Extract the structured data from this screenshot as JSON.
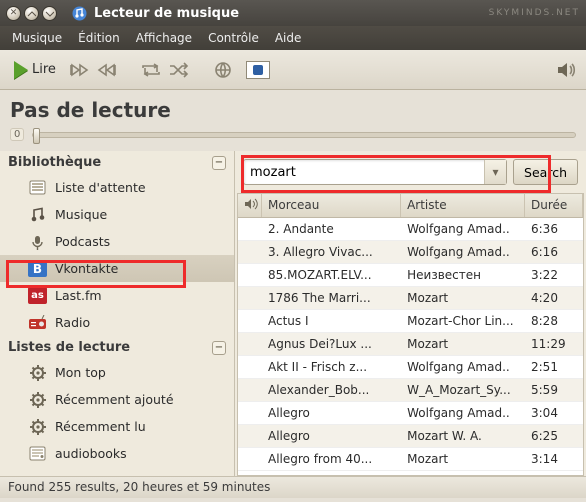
{
  "window": {
    "title": "Lecteur de musique",
    "watermark": "SKYMINDS.NET"
  },
  "menu": {
    "items": [
      "Musique",
      "Édition",
      "Affichage",
      "Contrôle",
      "Aide"
    ]
  },
  "toolbar": {
    "play_label": "Lire"
  },
  "nowplaying": {
    "title": "Pas de lecture",
    "time": "0"
  },
  "sidebar": {
    "library_header": "Bibliothèque",
    "library_items": [
      {
        "label": "Liste d'attente",
        "icon": "queue"
      },
      {
        "label": "Musique",
        "icon": "music"
      },
      {
        "label": "Podcasts",
        "icon": "podcast"
      },
      {
        "label": "Vkontakte",
        "icon": "vk",
        "selected": true
      },
      {
        "label": "Last.fm",
        "icon": "lastfm"
      },
      {
        "label": "Radio",
        "icon": "radio"
      }
    ],
    "playlists_header": "Listes de lecture",
    "playlist_items": [
      {
        "label": "Mon top"
      },
      {
        "label": "Récemment ajouté"
      },
      {
        "label": "Récemment lu"
      },
      {
        "label": "audiobooks"
      }
    ]
  },
  "search": {
    "value": "mozart",
    "button_label": "Search"
  },
  "table": {
    "headers": {
      "track": "Morceau",
      "artist": "Artiste",
      "duration": "Durée"
    },
    "rows": [
      {
        "track": "2. Andante",
        "artist": "Wolfgang Amad..",
        "duration": "6:36"
      },
      {
        "track": "3. Allegro Vivac...",
        "artist": "Wolfgang Amad..",
        "duration": "6:16"
      },
      {
        "track": "85.MOZART.ELV...",
        "artist": "Неизвестен",
        "duration": "3:22"
      },
      {
        "track": "1786 The Marri...",
        "artist": "Mozart",
        "duration": "4:20"
      },
      {
        "track": "Actus I",
        "artist": "Mozart-Chor Lin...",
        "duration": "8:28"
      },
      {
        "track": "Agnus Dei?Lux ...",
        "artist": "Mozart",
        "duration": "11:29"
      },
      {
        "track": "Akt II - Frisch z...",
        "artist": "Wolfgang Amad..",
        "duration": "2:51"
      },
      {
        "track": "Alexander_Bob...",
        "artist": "W_A_Mozart_Sy...",
        "duration": "5:59"
      },
      {
        "track": "Allegro",
        "artist": "Wolfgang Amad..",
        "duration": "3:04"
      },
      {
        "track": "Allegro",
        "artist": "Mozart W. A.",
        "duration": "6:25"
      },
      {
        "track": "Allegro from 40...",
        "artist": "Mozart",
        "duration": "3:14"
      }
    ]
  },
  "statusbar": {
    "text": "Found 255 results, 20 heures et 59 minutes"
  }
}
